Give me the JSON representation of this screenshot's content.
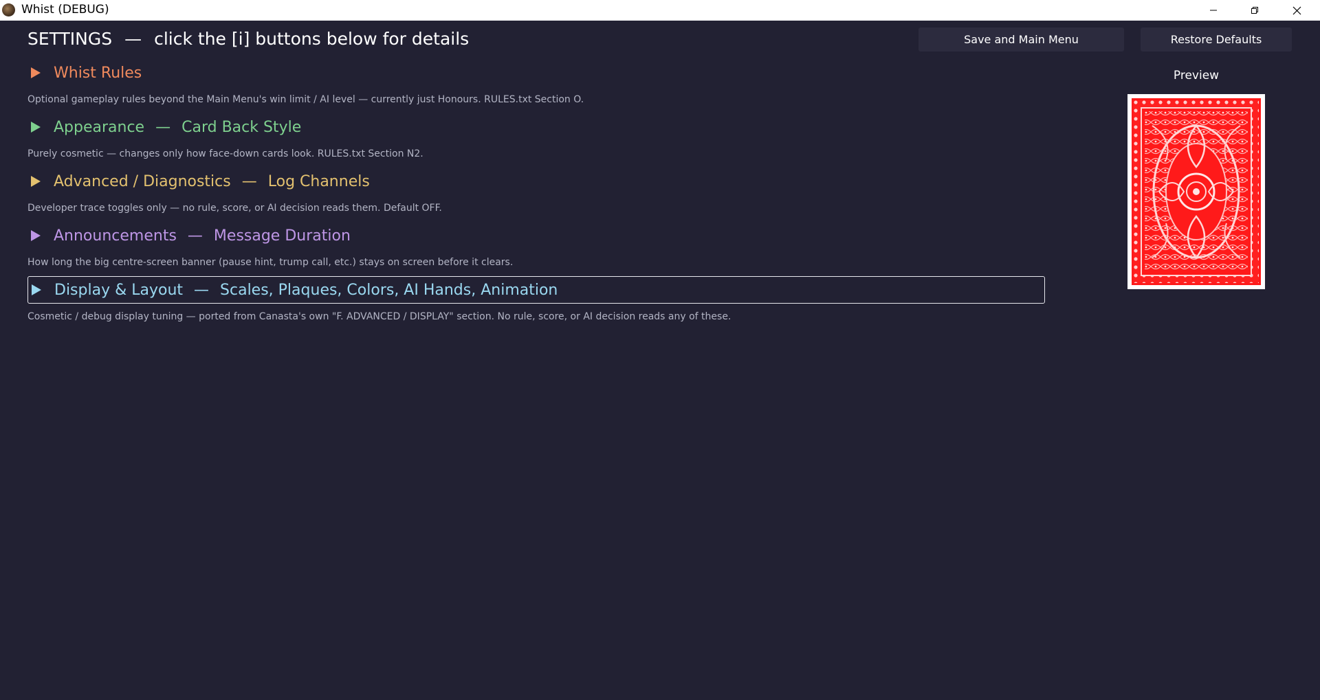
{
  "window": {
    "title": "Whist (DEBUG)",
    "icon": "app-icon",
    "controls": {
      "minimize": "minimize-icon",
      "maximize": "restore-window-icon",
      "close": "close-icon"
    }
  },
  "header": {
    "title": "SETTINGS",
    "separator": "—",
    "subtitle": "click the [i] buttons below for details"
  },
  "buttons": {
    "save_label": "Save and Main Menu",
    "restore_label": "Restore Defaults"
  },
  "sections": [
    {
      "title": "Whist Rules",
      "subtitle": "",
      "description": "Optional gameplay rules beyond the Main Menu's win limit / AI level — currently just Honours. RULES.txt Section O.",
      "color": "#f08a5d"
    },
    {
      "title": "Appearance",
      "subtitle": "Card Back Style",
      "description": "Purely cosmetic — changes only how face-down cards look. RULES.txt Section N2.",
      "color": "#7ed08e"
    },
    {
      "title": "Advanced / Diagnostics",
      "subtitle": "Log Channels",
      "description": "Developer trace toggles only — no rule, score, or AI decision reads them. Default OFF.",
      "color": "#e3c16f"
    },
    {
      "title": "Announcements",
      "subtitle": "Message Duration",
      "description": "How long the big centre-screen banner (pause hint, trump call, etc.) stays on screen before it clears.",
      "color": "#be96e6"
    },
    {
      "title": "Display & Layout",
      "subtitle": "Scales, Plaques, Colors, AI Hands, Animation",
      "description": "Cosmetic / debug display tuning — ported from Canasta's own \"F. ADVANCED / DISPLAY\" section. No rule, score, or AI decision reads any of these.",
      "color": "#9ad8f0",
      "focused": true
    }
  ],
  "preview": {
    "label": "Preview",
    "card_color": "#ff1a1a"
  },
  "colors": {
    "background": "#222133",
    "button_bg": "#2c2b3e"
  }
}
